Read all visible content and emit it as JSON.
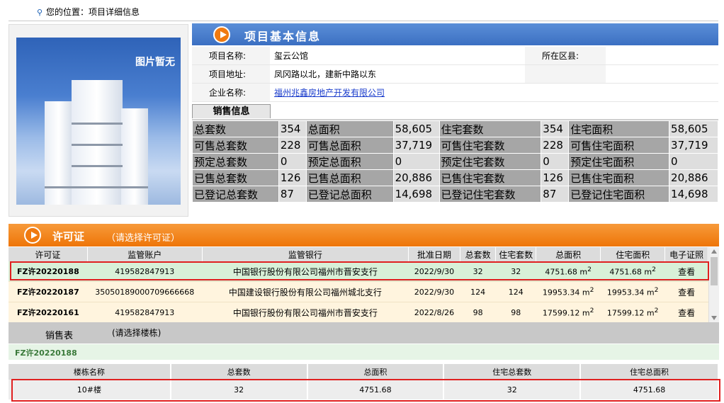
{
  "breadcrumb": {
    "label": "您的位置：",
    "current": "项目详细信息"
  },
  "photo": {
    "placeholder_text": "图片暂无"
  },
  "basic_info": {
    "header": "项目基本信息",
    "project_name_label": "项目名称:",
    "project_name": "玺云公馆",
    "district_label": "所在区县:",
    "district": "",
    "address_label": "项目地址:",
    "address": "凤冈路以北，建新中路以东",
    "company_label": "企业名称:",
    "company": "福州兆鑫房地产开发有限公司"
  },
  "sales_info": {
    "tab_label": "销售信息",
    "rows": [
      [
        "总套数",
        "354",
        "总面积",
        "58,605",
        "住宅套数",
        "354",
        "住宅面积",
        "58,605"
      ],
      [
        "可售总套数",
        "228",
        "可售总面积",
        "37,719",
        "可售住宅套数",
        "228",
        "可售住宅面积",
        "37,719"
      ],
      [
        "预定总套数",
        "0",
        "预定总面积",
        "0",
        "预定住宅套数",
        "0",
        "预定住宅面积",
        "0"
      ],
      [
        "已售总套数",
        "126",
        "已售总面积",
        "20,886",
        "已售住宅套数",
        "126",
        "已售住宅面积",
        "20,886"
      ],
      [
        "已登记总套数",
        "87",
        "已登记总面积",
        "14,698",
        "已登记住宅套数",
        "87",
        "已登记住宅面积",
        "14,698"
      ]
    ]
  },
  "permit": {
    "header": "许可证",
    "hint": "（请选择许可证）",
    "columns": [
      "许可证",
      "监管账户",
      "监管银行",
      "批准日期",
      "总套数",
      "住宅套数",
      "总面积",
      "住宅面积",
      "电子证照"
    ],
    "area_unit": "m",
    "area_sup": "2",
    "rows": [
      {
        "id": "FZ许20220188",
        "account": "419582847913",
        "bank": "中国银行股份有限公司福州市晋安支行",
        "date": "2022/9/30",
        "total": "32",
        "res": "32",
        "area": "4751.68",
        "res_area": "4751.68",
        "action": "查看"
      },
      {
        "id": "FZ许20220187",
        "account": "35050189000709666668",
        "bank": "中国建设银行股份有限公司福州城北支行",
        "date": "2022/9/30",
        "total": "124",
        "res": "124",
        "area": "19953.34",
        "res_area": "19953.34",
        "action": "查看"
      },
      {
        "id": "FZ许20220161",
        "account": "419582847913",
        "bank": "中国银行股份有限公司福州市晋安支行",
        "date": "2022/8/26",
        "total": "98",
        "res": "98",
        "area": "17599.12",
        "res_area": "17599.12",
        "action": "查看"
      }
    ]
  },
  "sales_table": {
    "title": "销售表",
    "hint": "(请选择楼栋)",
    "selected_permit": "FZ许20220188",
    "columns": [
      "楼栋名称",
      "总套数",
      "总面积",
      "住宅总套数",
      "住宅总面积"
    ],
    "rows": [
      {
        "name": "10#楼",
        "total": "32",
        "area": "4751.68",
        "res": "32",
        "res_area": "4751.68"
      }
    ]
  },
  "colors": {
    "blue_header": "#3b6fc2",
    "orange_header": "#ee7508",
    "highlight_red": "#e02020"
  }
}
